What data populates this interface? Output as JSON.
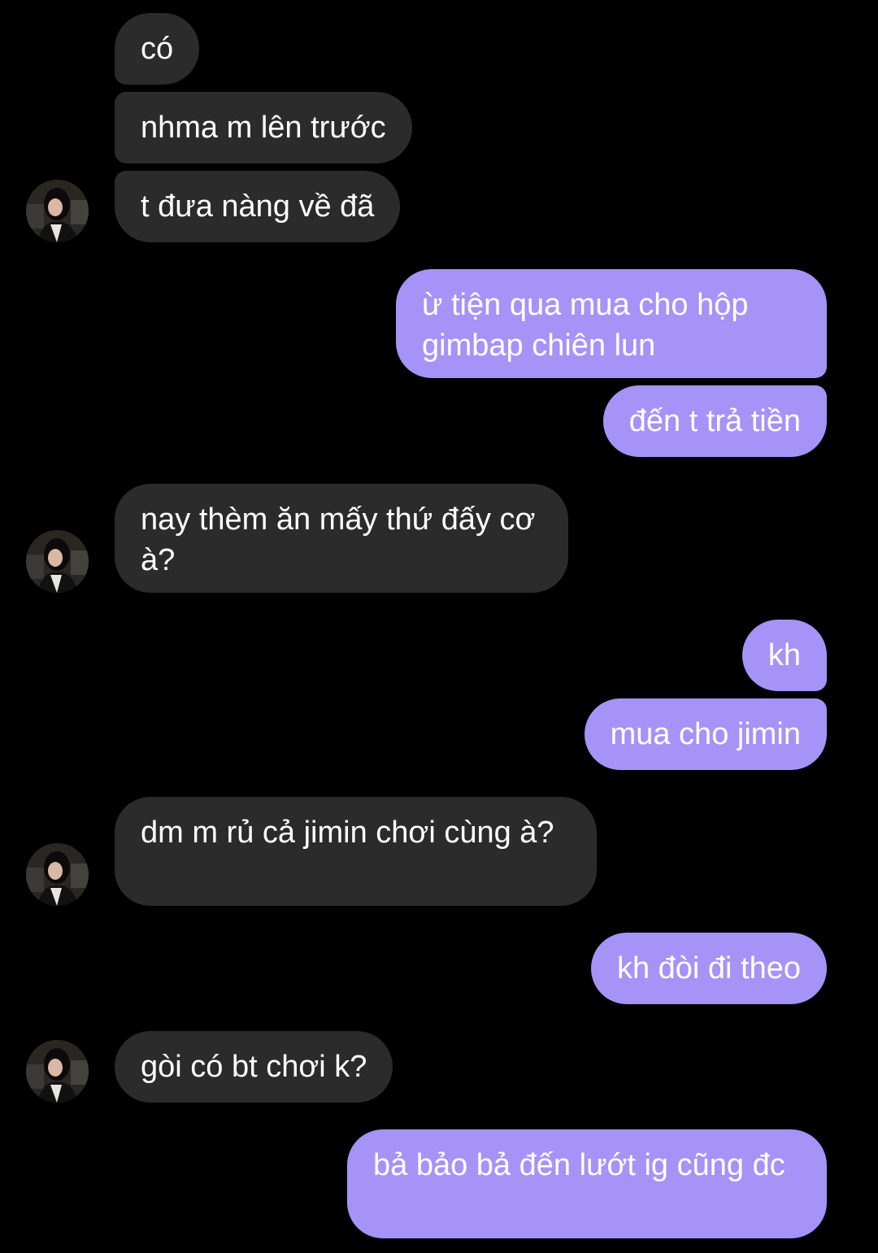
{
  "colors": {
    "background": "#000000",
    "incoming_bubble": "#2b2b2b",
    "outgoing_bubble": "#a593f7",
    "text": "#ffffff"
  },
  "messages": [
    {
      "sender": "them",
      "text": "có"
    },
    {
      "sender": "them",
      "text": "nhma m lên trước"
    },
    {
      "sender": "them",
      "text": "t đưa nàng về đã"
    },
    {
      "sender": "me",
      "text": "ừ tiện qua mua cho hộp gimbap chiên lun"
    },
    {
      "sender": "me",
      "text": "đến t trả tiền"
    },
    {
      "sender": "them",
      "text": "nay thèm ăn mấy thứ đấy cơ à?"
    },
    {
      "sender": "me",
      "text": "kh"
    },
    {
      "sender": "me",
      "text": "mua cho jimin"
    },
    {
      "sender": "them",
      "text": "dm m rủ cả jimin chơi cùng à?"
    },
    {
      "sender": "me",
      "text": "kh đòi đi theo"
    },
    {
      "sender": "them",
      "text": "gòi có bt chơi k?"
    },
    {
      "sender": "me",
      "text": "bả bảo bả đến lướt ig cũng đc"
    }
  ],
  "avatar_icon": "profile-photo-icon"
}
